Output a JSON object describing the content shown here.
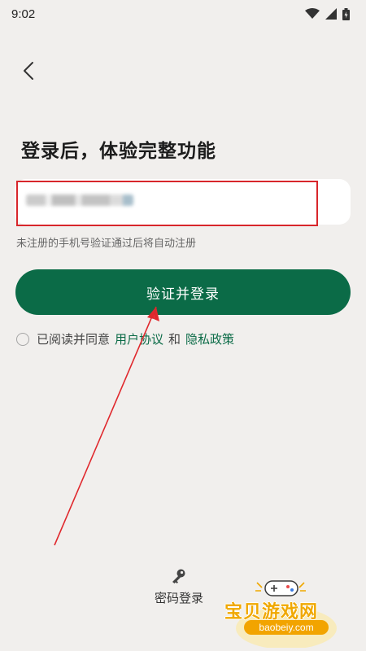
{
  "status_bar": {
    "time": "9:02"
  },
  "header": {
    "back_icon": "chevron-left-icon"
  },
  "login": {
    "title": "登录后，体验完整功能",
    "phone_input": {
      "value": "",
      "placeholder": ""
    },
    "hint": "未注册的手机号验证通过后将自动注册",
    "submit_label": "验证并登录",
    "agreement": {
      "prefix": "已阅读并同意",
      "user_agreement": "用户协议",
      "joiner": "和",
      "privacy_policy": "隐私政策"
    },
    "alt_login": {
      "icon": "key-icon",
      "label": "密码登录"
    }
  },
  "watermark": {
    "title": "宝贝游戏网",
    "url": "baobeiy.com"
  },
  "colors": {
    "primary": "#0b6b47",
    "highlight": "#d8262b",
    "background": "#f1efed"
  }
}
